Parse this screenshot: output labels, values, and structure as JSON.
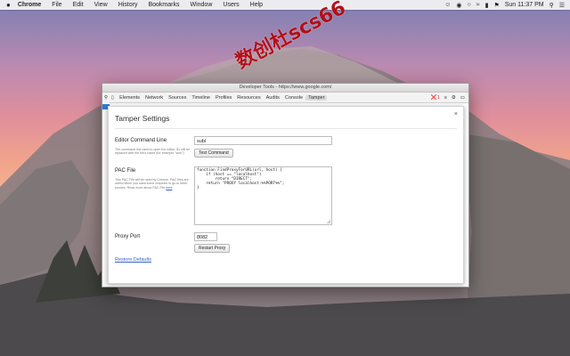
{
  "menubar": {
    "app": "Chrome",
    "items": [
      "File",
      "Edit",
      "View",
      "History",
      "Bookmarks",
      "Window",
      "Users",
      "Help"
    ],
    "clock": "Sun 11:37 PM",
    "icons": [
      "apple-logo",
      "ghost-icon",
      "record-icon",
      "circle-icon",
      "wifi-icon",
      "battery-icon",
      "flag-icon",
      "search-icon",
      "list-icon"
    ]
  },
  "devtools": {
    "title": "Developer Tools - https://www.google.com/",
    "tabs": [
      "Elements",
      "Network",
      "Sources",
      "Timeline",
      "Profiles",
      "Resources",
      "Audits",
      "Console",
      "Tamper"
    ],
    "active_tab": "Tamper",
    "error_count": "1"
  },
  "dialog": {
    "title": "Tamper Settings",
    "close": "×",
    "editor": {
      "label": "Editor Command Line",
      "desc": "The command line used to open the editor. $1 will be replaced with the file's name (for example \"subl\")",
      "value": "subl",
      "button": "Test Command"
    },
    "pac": {
      "label": "PAC File",
      "desc_before": "This PAC File will be used by Chrome. PAC files are useful when you want some requests to go to other proxies. Read more about PAC File ",
      "desc_link": "here",
      "desc_after": ".",
      "code": "function FindProxyForURL(url, host) {\n    if (host == \"localhost\")\n        return \"DIRECT\";\n    return \"PROXY localhost:%%PORT%%\";\n}"
    },
    "proxy": {
      "label": "Proxy Port",
      "value": "8082",
      "button": "Restart Proxy"
    },
    "restore": "Restore Defaults"
  },
  "watermark": "数创杜scs66",
  "colors": {
    "link": "#3a61c5",
    "error": "#dd2222",
    "watermark": "#b1101a",
    "active_blue": "#2d7bd9"
  }
}
